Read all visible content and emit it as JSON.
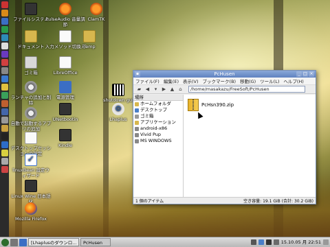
{
  "desktop": {
    "icons": [
      {
        "label": "ファイルシステム"
      },
      {
        "label": "PulseAudio 音量調節"
      },
      {
        "label": "ClamTK"
      },
      {
        "label": "ドキュメント"
      },
      {
        "label": "入力メソッド切換え"
      },
      {
        "label": "Temp"
      },
      {
        "label": "ゴミ箱"
      },
      {
        "label": "LibreOffice"
      },
      {
        "label": "ランチャの追加と削除"
      },
      {
        "label": "電源管理"
      },
      {
        "label": "shutdown gui"
      },
      {
        "label": "自動で起動するアプリの追加"
      },
      {
        "label": "UNetbootin"
      },
      {
        "label": "Lhaplus"
      },
      {
        "label": "デスクトップセッションの設定"
      },
      {
        "label": "Kindle"
      },
      {
        "label": "linuxBean 設定ウィザード"
      },
      {
        "label": "Linux Wine 日本語化"
      },
      {
        "label": "Mozilla Firefox"
      }
    ]
  },
  "window": {
    "title": "PcHusen",
    "menu": [
      "ファイル(F)",
      "編集(E)",
      "表示(V)",
      "ブックマーク(B)",
      "移動(G)",
      "ツール(L)",
      "ヘルプ(H)"
    ],
    "address": "/home/masakazu/FreeSoft/PcHusen",
    "side_header": "場所",
    "places": [
      {
        "label": "ホームフォルダ",
        "color": "#d7b74e"
      },
      {
        "label": "デスクトップ",
        "color": "#4a7fc8"
      },
      {
        "label": "ゴミ箱",
        "color": "#999999"
      },
      {
        "label": "アプリケーション",
        "color": "#d7b74e"
      },
      {
        "label": "android-x86",
        "color": "#888888"
      },
      {
        "label": "Vivid Pup",
        "color": "#888888"
      },
      {
        "label": "MS WINDOWS",
        "color": "#888888"
      }
    ],
    "file": {
      "name": "PcHsn390.zip"
    },
    "status_left": "1 個のアイテム",
    "status_right": "空き容量: 19.1 GiB (合計: 30.2 GiB)"
  },
  "taskbar": {
    "tasks": [
      "[Lhaplusのダウンロ...",
      "PcHusen"
    ],
    "clock": "15.10.05 月 22:51"
  }
}
